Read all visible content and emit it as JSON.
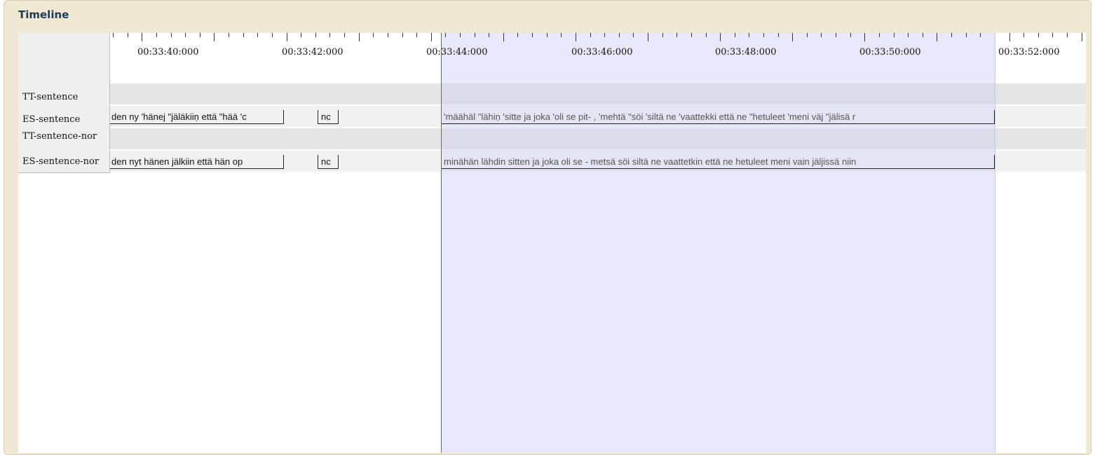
{
  "panel": {
    "title": "Timeline"
  },
  "ruler": {
    "labels": [
      "00:33:40:000",
      "00:33:42:000",
      "00:33:44:000",
      "00:33:46:000",
      "00:33:48:000",
      "00:33:50:000",
      "00:33:52:000"
    ]
  },
  "tiers": [
    {
      "label": "TT-sentence"
    },
    {
      "label": "ES-sentence"
    },
    {
      "label": "TT-sentence-nor"
    },
    {
      "label": "ES-sentence-nor"
    }
  ],
  "annotations": {
    "es_sentence": [
      "den ny 'hänej \"jäläkiiṇ että \"hää 'c",
      "nc",
      "'määhäl \"lähiṇ 'sitte ja joka 'oli se pit- , 'mehtä \"söi 'siltä ne 'vaattekki että ne \"hetuleet 'meni väj \"jälisä r"
    ],
    "es_sentence_nor": [
      "den nyt hänen jälkiin että hän op",
      "nc",
      "minähän lähdin sitten ja joka oli se - metsä söi siltä ne vaattetkin että ne hetuleet meni vain jäljissä niin"
    ]
  },
  "colors": {
    "cursor": "#e2334a",
    "selection": "#e8e8fb",
    "panel_bg": "#efe8d3",
    "title": "#1d3a57"
  }
}
